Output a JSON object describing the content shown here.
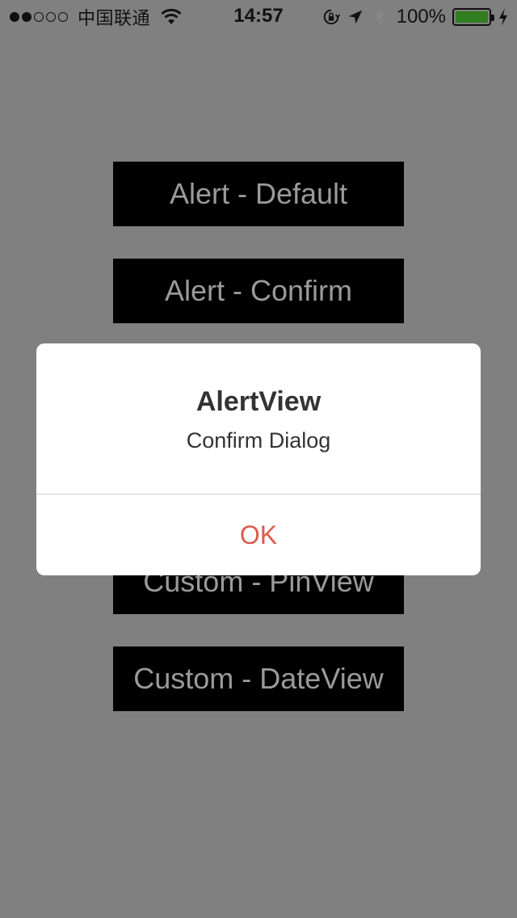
{
  "status_bar": {
    "signal_dots_filled": 2,
    "signal_dots_total": 5,
    "carrier": "中国联通",
    "time": "14:57",
    "battery_percent": "100%",
    "battery_level": 1.0,
    "icons": [
      "signal-icon",
      "wifi-icon",
      "rotation-lock-icon",
      "location-icon",
      "bluetooth-icon",
      "battery-icon",
      "charging-icon"
    ]
  },
  "buttons": {
    "alert_default": "Alert - Default",
    "alert_confirm": "Alert - Confirm",
    "custom_pinview": "Custom - PinView",
    "custom_dateview": "Custom - DateView"
  },
  "alert": {
    "title": "AlertView",
    "message": "Confirm Dialog",
    "ok_label": "OK"
  },
  "colors": {
    "background": "#808080",
    "button_bg": "#000000",
    "button_text": "#9a9a9a",
    "alert_bg": "#ffffff",
    "ok_text": "#dd5a4a",
    "battery_fill": "#2f7d1f"
  }
}
